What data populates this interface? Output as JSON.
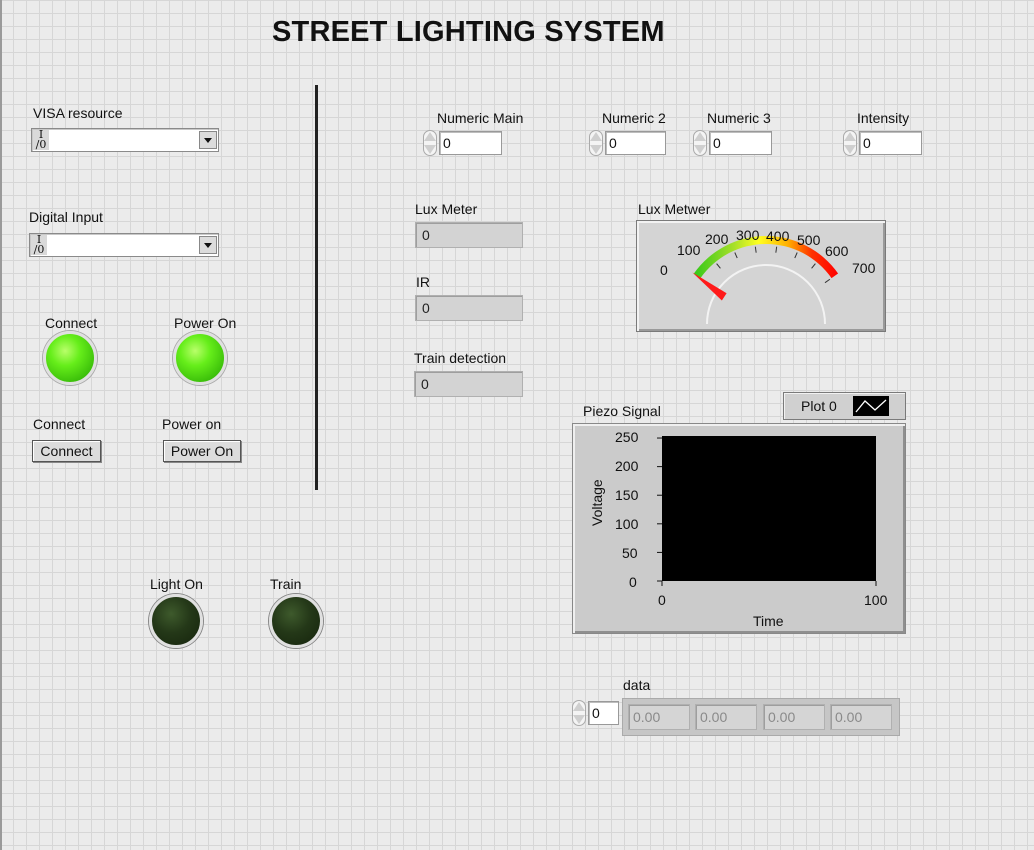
{
  "title": "STREET LIGHTING SYSTEM",
  "visa": {
    "label": "VISA resource",
    "value": "",
    "io_glyph": "I/0"
  },
  "digital": {
    "label": "Digital Input",
    "value": "",
    "io_glyph": "I/0"
  },
  "leds": {
    "connect": {
      "label": "Connect",
      "state": "on"
    },
    "power": {
      "label": "Power On",
      "state": "on"
    },
    "light": {
      "label": "Light On",
      "state": "off"
    },
    "train": {
      "label": "Train",
      "state": "off"
    }
  },
  "buttons": {
    "connect": {
      "caption": "Connect",
      "label": "Connect"
    },
    "power": {
      "caption": "Power on",
      "label": "Power On"
    }
  },
  "numerics": {
    "main": {
      "label": "Numeric Main",
      "value": "0"
    },
    "n2": {
      "label": "Numeric 2",
      "value": "0"
    },
    "n3": {
      "label": "Numeric 3",
      "value": "0"
    },
    "intensity": {
      "label": "Intensity",
      "value": "0"
    }
  },
  "indicators": {
    "lux": {
      "label": "Lux Meter",
      "value": "0"
    },
    "ir": {
      "label": "IR",
      "value": "0"
    },
    "train": {
      "label": "Train detection",
      "value": "0"
    }
  },
  "gauge": {
    "label": "Lux Metwer",
    "min": 0,
    "max": 700,
    "value": 0,
    "ticks": [
      "0",
      "100",
      "200",
      "300",
      "400",
      "500",
      "600",
      "700"
    ]
  },
  "graph": {
    "label": "Piezo Signal",
    "legend": "Plot 0",
    "xlabel": "Time",
    "ylabel": "Voltage",
    "yticks": [
      "0",
      "50",
      "100",
      "150",
      "200",
      "250"
    ],
    "xticks": [
      "0",
      "100"
    ]
  },
  "array": {
    "label": "data",
    "index": "0",
    "values": [
      "0.00",
      "0.00",
      "0.00",
      "0.00"
    ]
  }
}
